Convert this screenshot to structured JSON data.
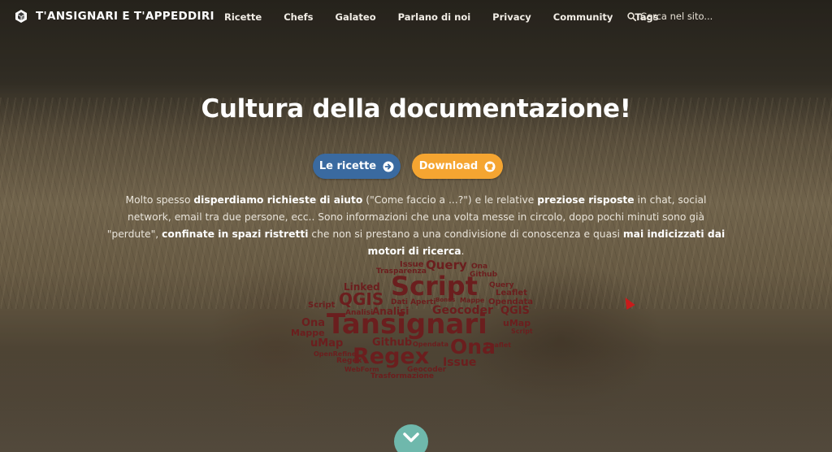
{
  "brand": {
    "name": "T'ANSIGNARI E T'APPEDDIRI",
    "logo_icon": "cube-icon"
  },
  "nav": {
    "items": [
      "Ricette",
      "Chefs",
      "Galateo",
      "Parlano di noi",
      "Privacy",
      "Community",
      "Tags"
    ],
    "search_placeholder": "Cerca nel sito..."
  },
  "hero": {
    "title": "Cultura della documentazione!",
    "buttons": {
      "recipes": {
        "label": "Le ricette",
        "icon": "arrow-right-circle-icon",
        "color": "#3a6aa0"
      },
      "download": {
        "label": "Download",
        "icon": "github-icon",
        "color": "#f5a531"
      }
    },
    "paragraph": [
      {
        "t": "Molto spesso ",
        "b": false
      },
      {
        "t": "disperdiamo richieste di aiuto",
        "b": true
      },
      {
        "t": " (\"Come faccio a ...?\") e le relative ",
        "b": false
      },
      {
        "t": "preziose risposte",
        "b": true
      },
      {
        "t": " in chat, social network, email tra due persone, ecc.. Sono informazioni che una volta messe in circolo, dopo pochi minuti sono già  \"perdute\", ",
        "b": false
      },
      {
        "t": "confinate in spazi ristretti",
        "b": true
      },
      {
        "t": " che non si prestano a una condivisione di conoscenza e quasi ",
        "b": false
      },
      {
        "t": "mai indicizzati dai motori di ricerca",
        "b": true
      },
      {
        "t": ".",
        "b": false
      }
    ]
  },
  "word_cloud": {
    "color": "#6b1e1e",
    "words": [
      "Issue",
      "Query",
      "Ona",
      "Trasparenza",
      "Github",
      "Linked",
      "Script",
      "QGIS",
      "Query",
      "Leaflet",
      "Dati Aperti",
      "Bonus",
      "Mappe",
      "Opendata",
      "Script",
      "Analisi",
      "Analisi",
      "Geocoder",
      "QGIS",
      "Ona",
      "Tansignari",
      "uMap",
      "Mappe",
      "Script",
      "uMap",
      "Github",
      "Regex",
      "Ona",
      "OpenRefine",
      "Regex",
      "Issue",
      "WebForm",
      "Geocoder",
      "Trasformazione",
      "Leaflet",
      "Opendata"
    ]
  },
  "scroll_icon": "chevron-down-icon"
}
